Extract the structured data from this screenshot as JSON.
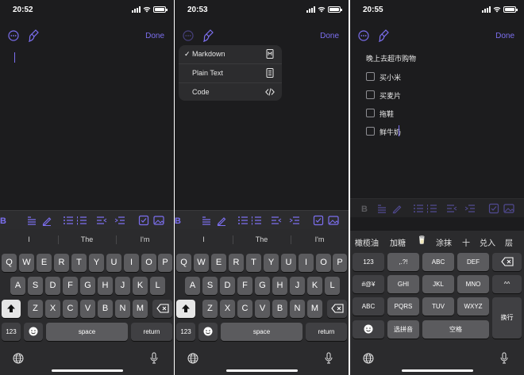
{
  "screens": [
    {
      "time": "20:52",
      "done": "Done"
    },
    {
      "time": "20:53",
      "done": "Done"
    },
    {
      "time": "20:55",
      "done": "Done"
    }
  ],
  "menu": {
    "check": "✓",
    "items": [
      {
        "label": "Markdown",
        "icon": "markdown-doc-icon"
      },
      {
        "label": "Plain Text",
        "icon": "text-doc-icon"
      },
      {
        "label": "Code",
        "icon": "code-brackets-icon"
      }
    ]
  },
  "note": {
    "title": "晚上去超市购物",
    "items": [
      "买小米",
      "买麦片",
      "拖鞋",
      "鲜牛奶"
    ]
  },
  "format_bar_icons": [
    "bold-icon",
    "highlight-text-icon",
    "pen-icon",
    "bullet-list-icon",
    "numbered-list-icon",
    "outdent-icon",
    "indent-icon",
    "checkbox-icon",
    "image-icon"
  ],
  "keyboard_en": {
    "suggestions": [
      "I",
      "The",
      "I'm"
    ],
    "row1": [
      "Q",
      "W",
      "E",
      "R",
      "T",
      "Y",
      "U",
      "I",
      "O",
      "P"
    ],
    "row2": [
      "A",
      "S",
      "D",
      "F",
      "G",
      "H",
      "J",
      "K",
      "L"
    ],
    "row3": [
      "Z",
      "X",
      "C",
      "V",
      "B",
      "N",
      "M"
    ],
    "numbers": "123",
    "space": "space",
    "return": "return"
  },
  "keyboard_zh": {
    "candidates": [
      "橄榄油",
      "加糖",
      "🥛",
      "涂抹",
      "十",
      "兑入",
      "层"
    ],
    "left_col": [
      "123",
      "#@¥",
      "ABC"
    ],
    "row1": [
      ",.?!",
      "ABC",
      "DEF"
    ],
    "row2": [
      "GHI",
      "JKL",
      "MNO"
    ],
    "row3": [
      "PQRS",
      "TUV",
      "WXYZ"
    ],
    "emoji_face": "^^",
    "pinyin": "选拼音",
    "space": "空格",
    "newline": "换行"
  },
  "colors": {
    "accent": "#7c6ff0",
    "background": "#1c1c1e",
    "key": "#5b5b5e",
    "key_dark": "#404043"
  }
}
